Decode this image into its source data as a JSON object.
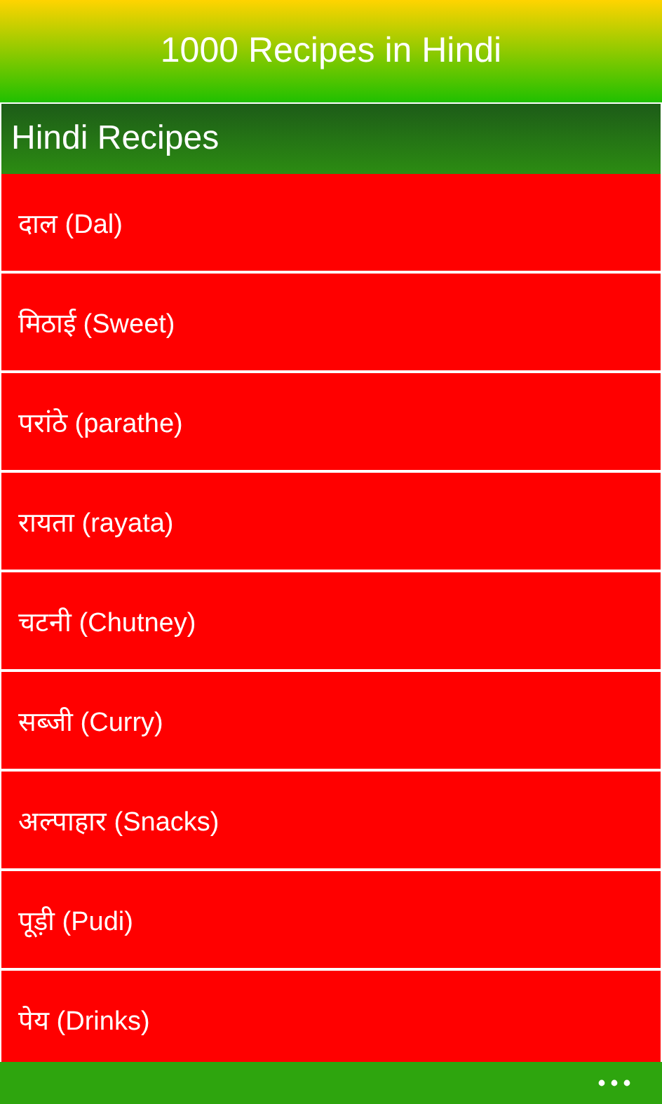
{
  "header": {
    "title": "1000 Recipes in Hindi"
  },
  "panel": {
    "title": "Hindi Recipes",
    "items": [
      {
        "label": "दाल (Dal)"
      },
      {
        "label": "मिठाई (Sweet)"
      },
      {
        "label": "परांठे (parathe)"
      },
      {
        "label": "रायता (rayata)"
      },
      {
        "label": "चटनी (Chutney)"
      },
      {
        "label": "सब्जी (Curry)"
      },
      {
        "label": "अल्पाहार (Snacks)"
      },
      {
        "label": "पूड़ी (Pudi)"
      },
      {
        "label": "पेय (Drinks)"
      }
    ]
  }
}
